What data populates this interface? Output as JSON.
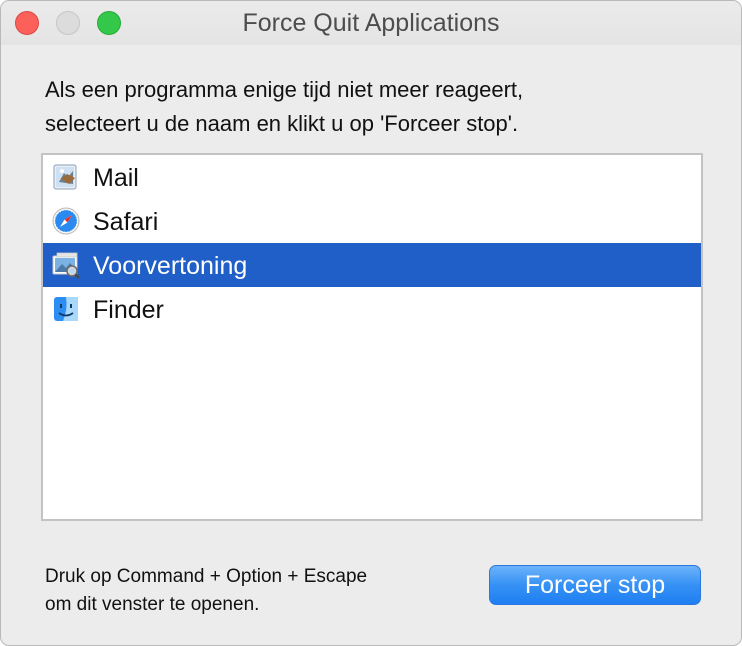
{
  "window": {
    "title": "Force Quit Applications"
  },
  "instructions": {
    "line1": "Als een programma enige tijd niet meer reageert,",
    "line2": "selecteert u de naam en klikt u op 'Forceer stop'."
  },
  "apps": [
    {
      "name": "Mail",
      "icon": "mail-icon",
      "selected": false
    },
    {
      "name": "Safari",
      "icon": "safari-icon",
      "selected": false
    },
    {
      "name": "Voorvertoning",
      "icon": "preview-icon",
      "selected": true
    },
    {
      "name": "Finder",
      "icon": "finder-icon",
      "selected": false
    }
  ],
  "footer": {
    "line1": "Druk op Command + Option + Escape",
    "line2": "om dit venster te openen."
  },
  "buttons": {
    "force_quit_label": "Forceer stop"
  },
  "colors": {
    "selection": "#1f5fc7",
    "button": "#3691f5",
    "close": "#fc605b",
    "zoom": "#34c84a"
  }
}
